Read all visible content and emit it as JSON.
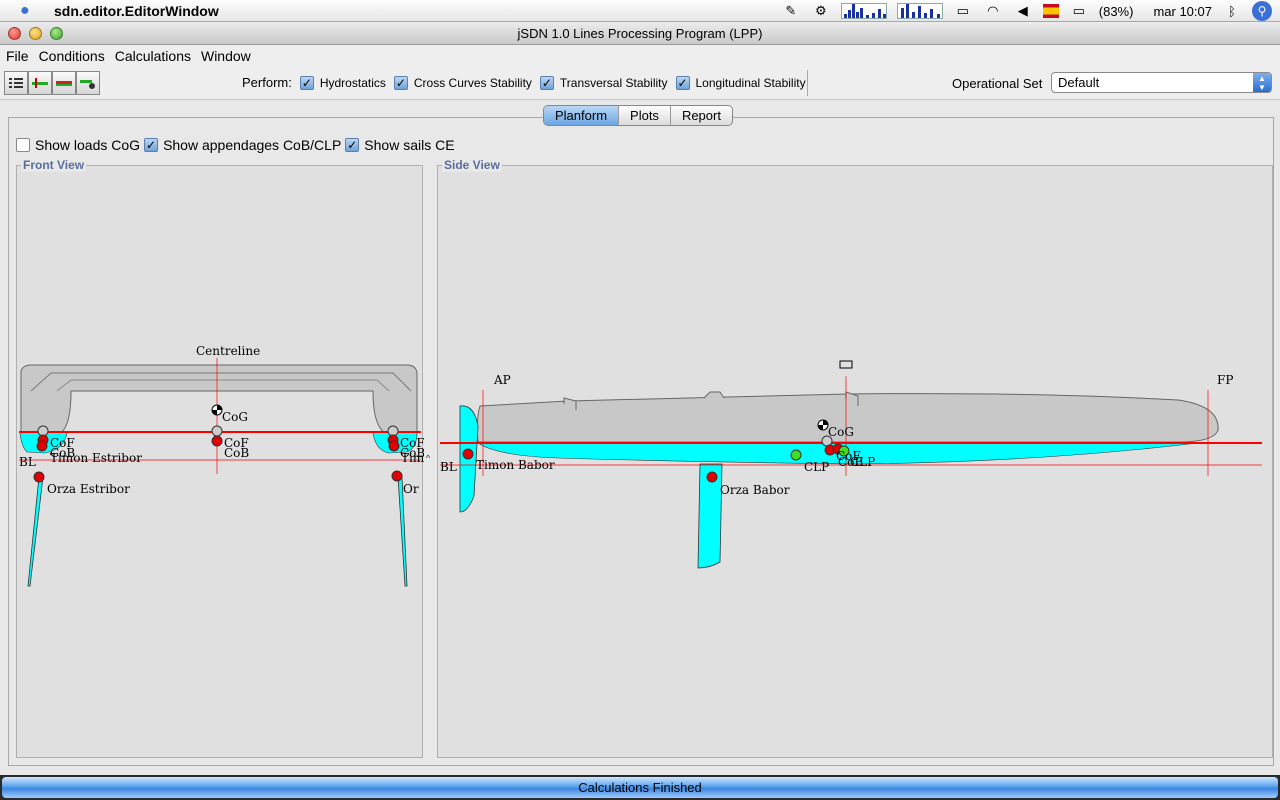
{
  "menubar": {
    "app_name": "sdn.editor.EditorWindow",
    "battery": "(83%)",
    "clock": "mar 10:07"
  },
  "window": {
    "title": "jSDN 1.0 Lines Processing Program (LPP)"
  },
  "menus": [
    "File",
    "Conditions",
    "Calculations",
    "Window"
  ],
  "toolbar": {
    "perform_label": "Perform:",
    "checks": [
      {
        "label": "Hydrostatics",
        "checked": true
      },
      {
        "label": "Cross Curves Stability",
        "checked": true
      },
      {
        "label": "Transversal Stability",
        "checked": true
      },
      {
        "label": "Longitudinal Stability",
        "checked": true
      }
    ],
    "opset_label": "Operational Set",
    "opset_value": "Default"
  },
  "tabs": [
    "Planform",
    "Plots",
    "Report"
  ],
  "active_tab": "Planform",
  "show_options": [
    {
      "label": "Show loads CoG",
      "checked": false
    },
    {
      "label": "Show appendages CoB/CLP",
      "checked": true
    },
    {
      "label": "Show sails CE",
      "checked": true
    }
  ],
  "front_view": {
    "title": "Front View",
    "labels": {
      "centreline": "Centreline",
      "cog": "CoG",
      "cof": "CoF",
      "cob": "CoB",
      "bl": "BL",
      "timon": "Timon Estribor",
      "orza": "Orza Estribor",
      "cof_r": "CoF",
      "cob_r": "CoB",
      "timon_r": "Tim",
      "orza_r": "Or",
      "cof_l": "CoF",
      "cob_l": "CoB"
    }
  },
  "side_view": {
    "title": "Side View",
    "labels": {
      "ap": "AP",
      "fp": "FP",
      "bl": "BL",
      "cog": "CoG",
      "clp": "CLP",
      "clp2": "CLP",
      "timon": "Timon Babor",
      "orza": "Orza Babor",
      "cob_cof": "CoF",
      "cob2": "CoB"
    }
  },
  "status": {
    "text": "Calculations Finished"
  },
  "colors": {
    "waterline": "#ff0000",
    "submerged": "#00ffff",
    "hull": "#c8c8c8",
    "point_red": "#e00000",
    "point_green": "#44dd22"
  }
}
